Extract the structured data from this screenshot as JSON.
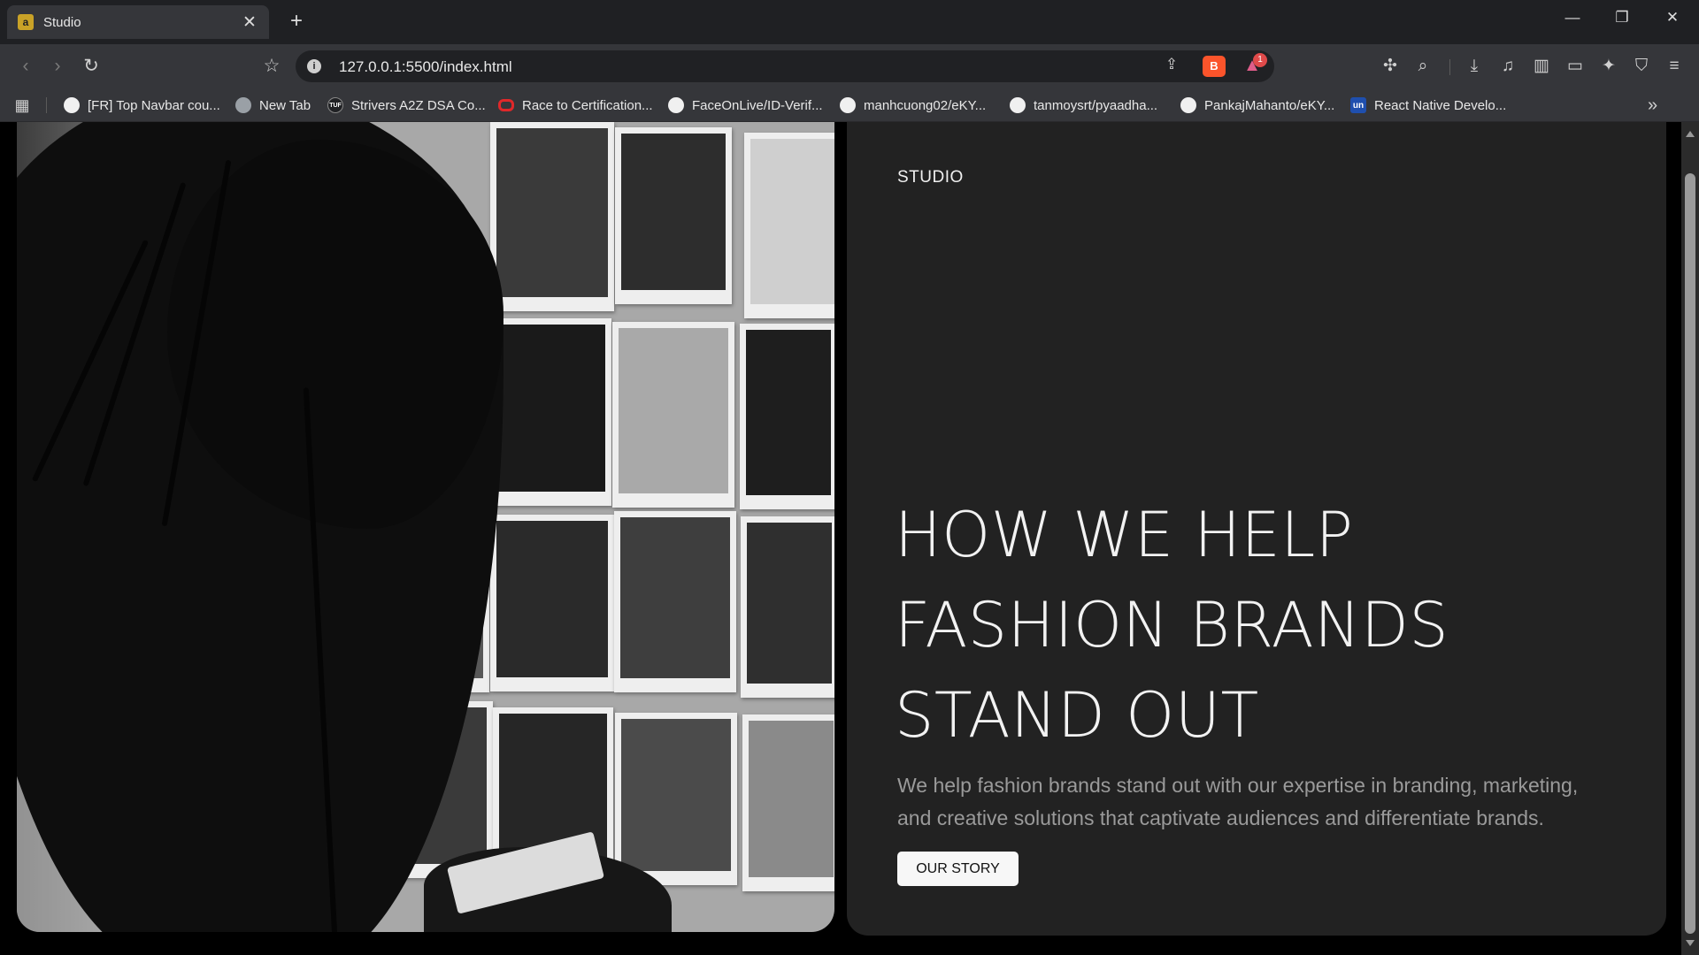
{
  "browser": {
    "tab": {
      "favicon_letter": "a",
      "title": "Studio",
      "close_glyph": "✕"
    },
    "new_tab_glyph": "+",
    "window_controls": {
      "minimize": "—",
      "restore": "❐",
      "close": "✕"
    },
    "nav": {
      "back": "‹",
      "forward": "›",
      "reload": "↻",
      "bookmark": "☆"
    },
    "address": {
      "info_glyph": "i",
      "url": "127.0.0.1:5500/index.html"
    },
    "omnibox_icons": {
      "share": "⇪",
      "brave": "B",
      "rewards": "▲",
      "rewards_badge": "1"
    },
    "toolbar_icons": [
      "extensions-icon",
      "screenshot-icon",
      "download-icon",
      "media-icon",
      "sidebar-icon",
      "wallet-icon",
      "leo-ai-icon",
      "vpn-icon",
      "menu-icon"
    ],
    "toolbar_glyphs": {
      "extensions": "✣",
      "screenshot": "⌕",
      "download": "⤓",
      "media": "♫",
      "sidebar": "▥",
      "wallet": "▭",
      "leo": "✦",
      "vpn": "⛉",
      "menu": "≡"
    }
  },
  "bookmarks": {
    "apps_glyph": "▦",
    "items": [
      {
        "label": "[FR] Top Navbar cou...",
        "icon": "github-icon",
        "glyph": ""
      },
      {
        "label": "New Tab",
        "icon": "globe-icon",
        "glyph": ""
      },
      {
        "label": "Strivers A2Z DSA Co...",
        "icon": "tuf-icon",
        "glyph": "TUF"
      },
      {
        "label": "Race to Certification...",
        "icon": "oracle-icon",
        "glyph": ""
      },
      {
        "label": "FaceOnLive/ID-Verif...",
        "icon": "github-icon",
        "glyph": ""
      },
      {
        "label": "manhcuong02/eKY...",
        "icon": "github-icon",
        "glyph": ""
      },
      {
        "label": "tanmoysrt/pyaadha...",
        "icon": "github-icon",
        "glyph": ""
      },
      {
        "label": "PankajMahanto/eKY...",
        "icon": "github-icon",
        "glyph": ""
      },
      {
        "label": "React Native Develo...",
        "icon": "unstop-icon",
        "glyph": "un"
      }
    ],
    "more_glyph": "»"
  },
  "page": {
    "brand": "STUDIO",
    "headline": [
      "HOW WE HELP",
      "FASHION BRANDS",
      "STAND OUT"
    ],
    "description": "We help fashion brands stand out with our expertise in branding, marketing, and creative solutions that captivate audiences and differentiate brands.",
    "cta_label": "OUR STORY",
    "hero_image": "woman-viewing-fashion-photo-wall"
  },
  "colors": {
    "panel_bg": "#222222",
    "page_bg": "#000000",
    "headline": "#f2f2f2",
    "description": "#9a9a9a",
    "button_bg": "#f7f7f7"
  }
}
